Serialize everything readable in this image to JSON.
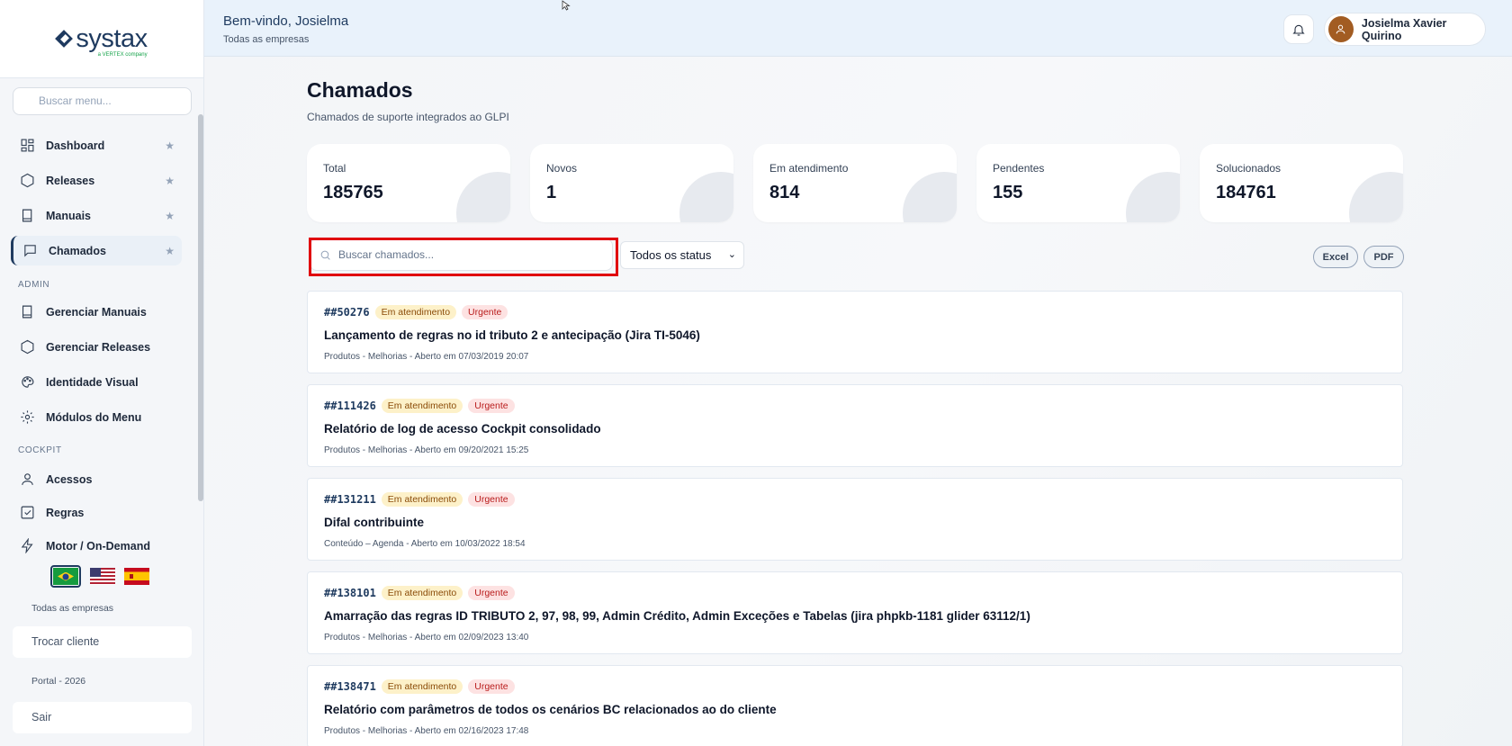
{
  "brand": {
    "name": "systax",
    "tagline": "a VERTEX company"
  },
  "sidebar": {
    "search_placeholder": "Buscar menu...",
    "items": [
      {
        "label": "Dashboard",
        "icon": "dashboard-icon",
        "starred": true
      },
      {
        "label": "Releases",
        "icon": "hexagon-icon",
        "starred": true
      },
      {
        "label": "Manuais",
        "icon": "book-icon",
        "starred": true
      },
      {
        "label": "Chamados",
        "icon": "chat-icon",
        "starred": true,
        "active": true
      }
    ],
    "admin_label": "ADMIN",
    "admin_items": [
      {
        "label": "Gerenciar Manuais",
        "icon": "book-icon"
      },
      {
        "label": "Gerenciar Releases",
        "icon": "hexagon-icon"
      },
      {
        "label": "Identidade Visual",
        "icon": "palette-icon"
      },
      {
        "label": "Módulos do Menu",
        "icon": "gear-icon"
      }
    ],
    "cockpit_label": "COCKPIT",
    "cockpit_items": [
      {
        "label": "Acessos",
        "icon": "user-icon"
      },
      {
        "label": "Regras",
        "icon": "checkbox-icon"
      },
      {
        "label": "Motor / On-Demand",
        "icon": "lightning-icon"
      }
    ],
    "languages": [
      "pt-BR",
      "en-US",
      "es-ES"
    ],
    "company_scope": "Todas as empresas",
    "switch_client": "Trocar cliente",
    "footer": "Portal - 2026",
    "logout": "Sair"
  },
  "header": {
    "welcome": "Bem-vindo, Josielma",
    "company": "Todas as empresas",
    "user_name": "Josielma Xavier Quirino"
  },
  "page": {
    "title": "Chamados",
    "subtitle": "Chamados de suporte integrados ao GLPI"
  },
  "stats": [
    {
      "label": "Total",
      "value": "185765"
    },
    {
      "label": "Novos",
      "value": "1"
    },
    {
      "label": "Em atendimento",
      "value": "814"
    },
    {
      "label": "Pendentes",
      "value": "155"
    },
    {
      "label": "Solucionados",
      "value": "184761"
    }
  ],
  "filters": {
    "search_placeholder": "Buscar chamados...",
    "status_selected": "Todos os status",
    "excel_label": "Excel",
    "pdf_label": "PDF"
  },
  "tickets": [
    {
      "id": "##50276",
      "status": "Em atendimento",
      "priority": "Urgente",
      "title": "Lançamento de regras no id tributo 2 e antecipação (Jira TI-5046)",
      "meta": "Produtos - Melhorias - Aberto em 07/03/2019 20:07"
    },
    {
      "id": "##111426",
      "status": "Em atendimento",
      "priority": "Urgente",
      "title": "Relatório de log de acesso Cockpit consolidado",
      "meta": "Produtos - Melhorias - Aberto em 09/20/2021 15:25"
    },
    {
      "id": "##131211",
      "status": "Em atendimento",
      "priority": "Urgente",
      "title": "Difal contribuinte",
      "meta": "Conteúdo – Agenda - Aberto em 10/03/2022 18:54"
    },
    {
      "id": "##138101",
      "status": "Em atendimento",
      "priority": "Urgente",
      "title": "Amarração das regras ID TRIBUTO 2, 97, 98, 99, Admin Crédito, Admin Exceções e Tabelas (jira phpkb-1181 glider 63112/1)",
      "meta": "Produtos - Melhorias - Aberto em 02/09/2023 13:40"
    },
    {
      "id": "##138471",
      "status": "Em atendimento",
      "priority": "Urgente",
      "title": "Relatório com parâmetros de todos os cenários BC relacionados ao do cliente",
      "meta": "Produtos - Melhorias - Aberto em 02/16/2023 17:48"
    }
  ]
}
